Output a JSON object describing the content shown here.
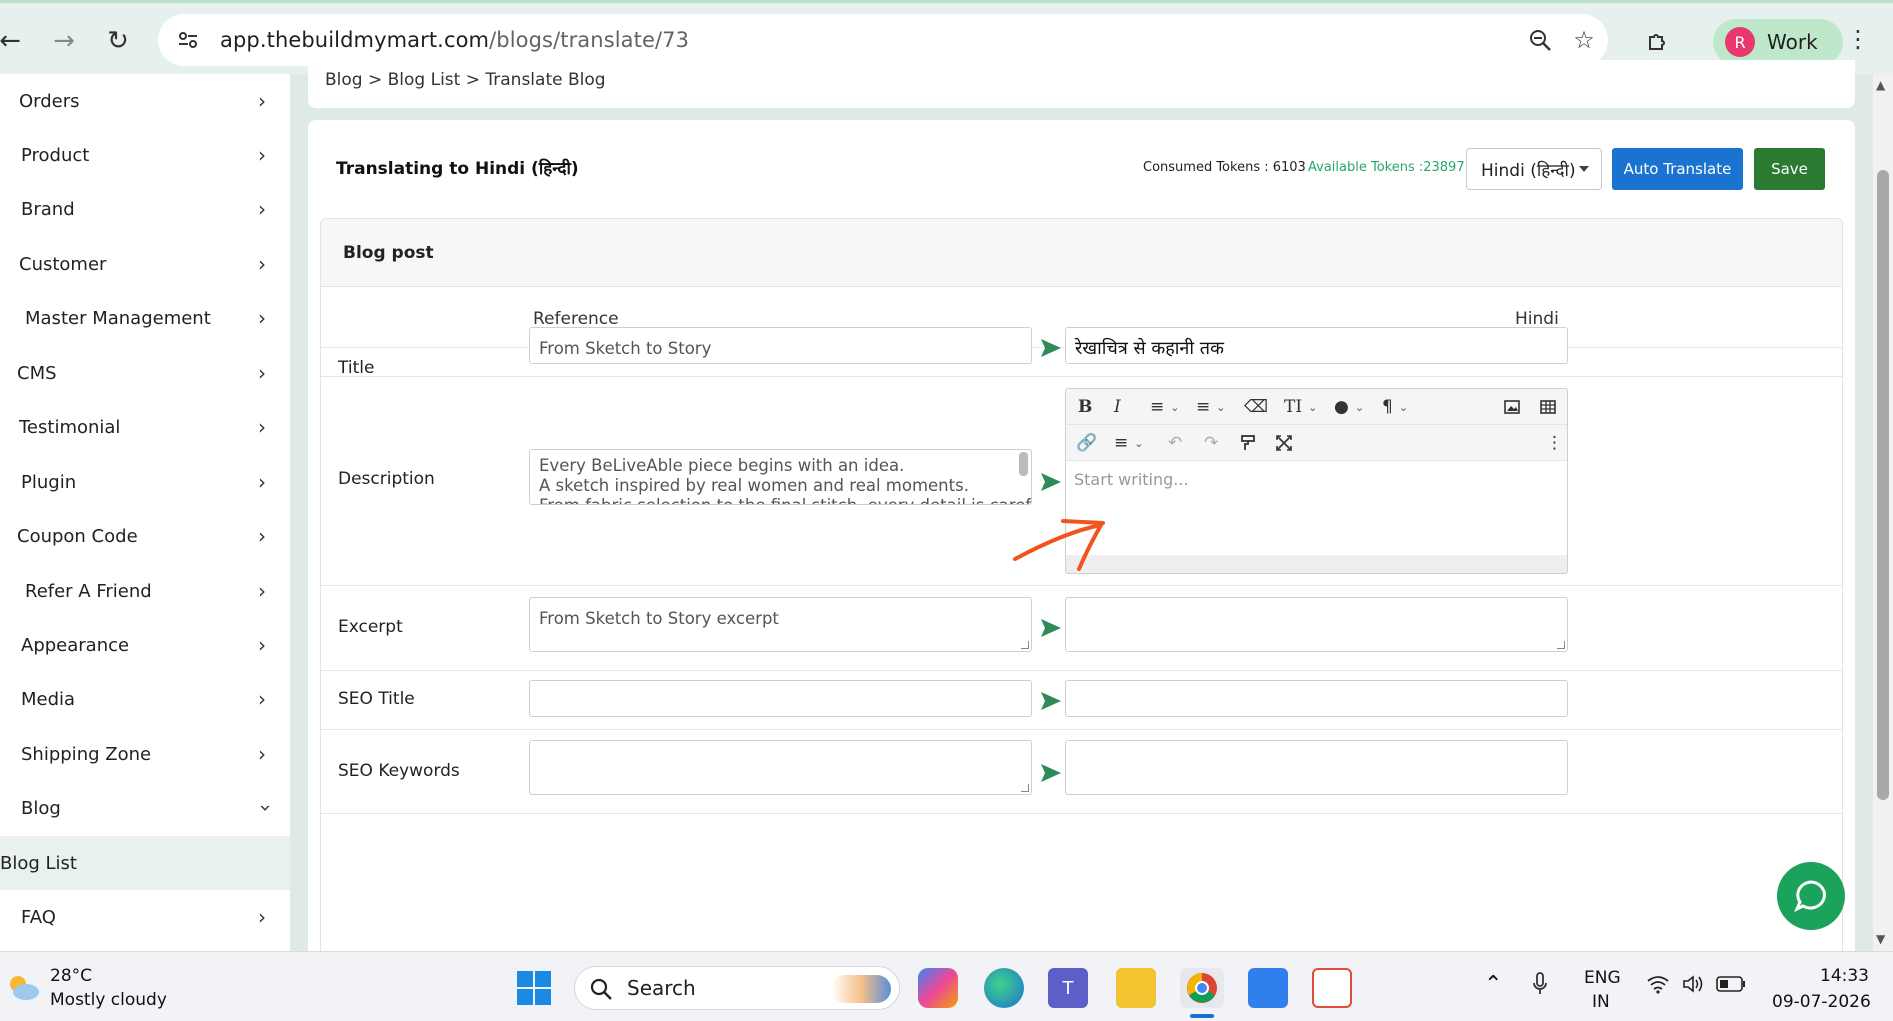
{
  "browser": {
    "url_host": "app.thebuildmymart.com",
    "url_path": "/blogs/translate/73",
    "profile_initial": "R",
    "profile_name": "Work"
  },
  "sidebar": {
    "items": [
      {
        "label": "Orders"
      },
      {
        "label": "Product"
      },
      {
        "label": "Brand"
      },
      {
        "label": "Customer"
      },
      {
        "label": "Master Management"
      },
      {
        "label": "CMS"
      },
      {
        "label": "Testimonial"
      },
      {
        "label": "Plugin"
      },
      {
        "label": "Coupon Code"
      },
      {
        "label": "Refer A Friend"
      },
      {
        "label": "Appearance"
      },
      {
        "label": "Media"
      },
      {
        "label": "Shipping Zone"
      },
      {
        "label": "Blog"
      },
      {
        "label": "Blog List"
      },
      {
        "label": "FAQ"
      }
    ]
  },
  "breadcrumb": {
    "text": "Blog > Blog List > Translate Blog"
  },
  "header": {
    "title": "Translating to Hindi (हिन्दी)",
    "consumed_tokens": "Consumed Tokens : 6103",
    "available_tokens": "Available Tokens :23897",
    "language_selected": "Hindi (हिन्दी)",
    "auto_translate_label": "Auto Translate",
    "save_label": "Save"
  },
  "form": {
    "section_title": "Blog post",
    "col_reference": "Reference",
    "col_target": "Hindi",
    "rows": {
      "title": {
        "label": "Title",
        "reference": "From Sketch to Story",
        "target": "रेखाचित्र से कहानी तक"
      },
      "description": {
        "label": "Description",
        "reference_line1": "Every BeLiveAble piece begins with an idea.",
        "reference_line2": "A sketch inspired by real women and real moments.",
        "reference_line3": "From fabric selection to the final stitch, every detail is carefully",
        "editor_placeholder": "Start writing..."
      },
      "excerpt": {
        "label": "Excerpt",
        "reference": "From Sketch to Story excerpt",
        "target": ""
      },
      "seo_title": {
        "label": "SEO Title",
        "reference": "",
        "target": ""
      },
      "seo_keywords": {
        "label": "SEO Keywords",
        "reference": "",
        "target": ""
      }
    }
  },
  "taskbar": {
    "temperature": "28°C",
    "weather": "Mostly cloudy",
    "search_label": "Search",
    "lang_top": "ENG",
    "lang_bottom": "IN",
    "time": "14:33",
    "date": "09-07-2026"
  },
  "colors": {
    "accent_blue": "#1a73d1",
    "save_green": "#2a7a32",
    "send_green": "#2e8b57",
    "token_green": "#2aa66a",
    "annotation_orange": "#f0551e"
  }
}
